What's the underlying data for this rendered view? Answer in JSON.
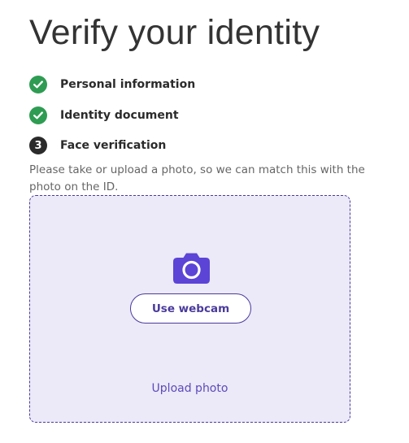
{
  "page": {
    "title": "Verify your identity"
  },
  "steps": [
    {
      "label": "Personal information",
      "status": "complete",
      "icon": "check-icon"
    },
    {
      "label": "Identity document",
      "status": "complete",
      "icon": "check-icon"
    },
    {
      "label": "Face verification",
      "status": "current",
      "number": "3"
    }
  ],
  "instructions": "Please take or upload a photo, so we can match this with the photo on the ID.",
  "upload_zone": {
    "icon": "camera-icon",
    "webcam_button_label": "Use webcam",
    "upload_link_label": "Upload photo"
  },
  "colors": {
    "success": "#2e9c52",
    "accent": "#4a3b9c",
    "dropzone_background": "#ece9f9",
    "camera_icon": "#5b44d6"
  }
}
